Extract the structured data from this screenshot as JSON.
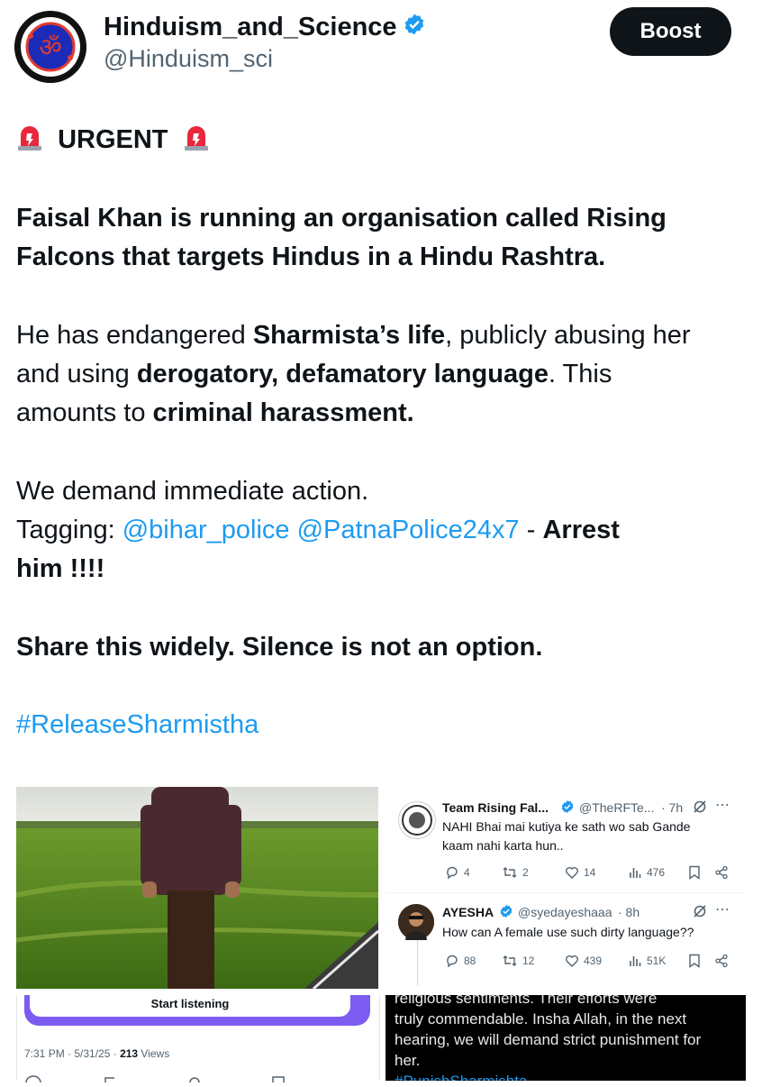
{
  "header": {
    "display_name": "Hinduism_and_Science",
    "handle": "@Hinduism_sci",
    "boost_label": "Boost"
  },
  "tweet": {
    "urgent": "URGENT",
    "p1_line1": "Faisal Khan is running an organisation called Rising",
    "p1_line2": "Falcons that targets Hindus in a Hindu Rashtra.",
    "p2_a": "He has endangered ",
    "p2_b": "Sharmista’s life",
    "p2_c": ", publicly abusing her",
    "p2_d": "and using ",
    "p2_e": "derogatory, defamatory language",
    "p2_f": ". This",
    "p2_g": "amounts to ",
    "p2_h": "criminal harassment.",
    "p3_line1": "We demand immediate action.",
    "p3_tagging": "Tagging: ",
    "p3_mention1": "@bihar_police",
    "p3_mention2": "@PatnaPolice24x7",
    "p3_dash": " - ",
    "p3_arrest": "Arrest",
    "p3_him": "him !!!!",
    "p4": "Share this widely. Silence is not an option.",
    "hashtag": "#ReleaseSharmistha"
  },
  "embedded_tweets": [
    {
      "name": "Team Rising Fal...",
      "handle": "@TheRFTe...",
      "time": "· 7h",
      "text_line1": "NAHI Bhai mai kutiya ke sath wo sab Gande",
      "text_line2": "kaam nahi karta hun..",
      "replies": "4",
      "reposts": "2",
      "likes": "14",
      "views": "476"
    },
    {
      "name": "AYESHA",
      "handle": "@syedayeshaaa",
      "time": "· 8h",
      "text_line1": "How can A female use such dirty language??",
      "replies": "88",
      "reposts": "12",
      "likes": "439",
      "views": "51K"
    }
  ],
  "bottom_left": {
    "start_listening": "Start listening",
    "timestamp_prefix": "7:31 PM · 5/31/25 · ",
    "views_count": "213",
    "views_label": " Views"
  },
  "bottom_right": {
    "line0": "religious sentiments. Their efforts were",
    "line1": "truly commendable. Insha Allah, in the next",
    "line2": "hearing, we will demand strict punishment for",
    "line3": "her.",
    "line4": "#PunishSharmishta"
  },
  "colors": {
    "link": "#1d9bf0",
    "text": "#0f1419",
    "secondary": "#536471",
    "boost_bg": "#0f1419",
    "listen_purple": "#7c5cf0"
  }
}
